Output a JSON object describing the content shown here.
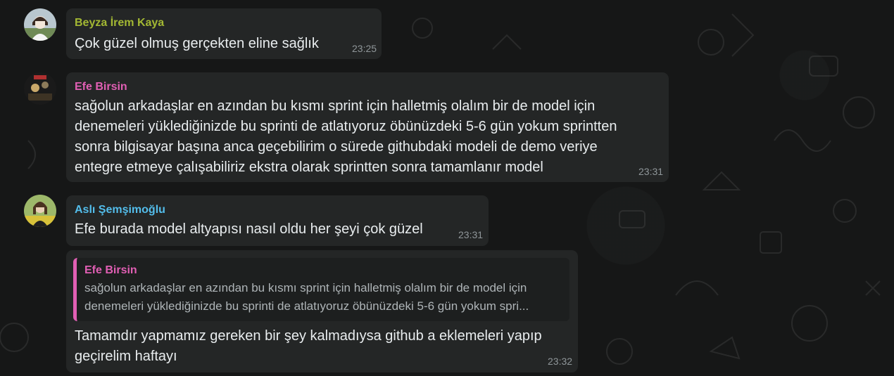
{
  "colors": {
    "background": "#161717",
    "bubble": "#242626",
    "message_text": "#e9edef",
    "time_text": "#8f9699"
  },
  "messages": [
    {
      "sender": "Beyza İrem Kaya",
      "sender_color": "#a3b833",
      "lines": [
        "Çok güzel olmuş gerçekten eline sağlık"
      ],
      "time": "23:25"
    },
    {
      "sender": "Efe Birsin",
      "sender_color": "#e15fb4",
      "lines": [
        "sağolun arkadaşlar en azından bu kısmı sprint için halletmiş olalım bir de model için",
        "denemeleri yüklediğinizde bu sprinti de atlatıyoruz öbünüzdeki 5-6 gün yokum sprintten",
        "sonra bilgisayar başına anca geçebilirim o sürede githubdaki modeli de demo veriye",
        "entegre etmeye çalışabiliriz ekstra olarak sprintten sonra tamamlanır model"
      ],
      "time": "23:31"
    },
    {
      "sender": "Aslı Şemşimoğlu",
      "sender_color": "#53bdeb",
      "lines": [
        "Efe burada model altyapısı nasıl oldu her şeyi çok güzel"
      ],
      "time": "23:31"
    },
    {
      "quote": {
        "sender": "Efe Birsin",
        "lines": [
          "sağolun arkadaşlar en azından bu kısmı sprint için halletmiş olalım bir de model için",
          "denemeleri yüklediğinizde bu sprinti de atlatıyoruz öbünüzdeki 5-6 gün yokum spri..."
        ]
      },
      "lines": [
        "Tamamdır yapmamız gereken bir şey kalmadıysa github a eklemeleri yapıp",
        "geçirelim haftayı"
      ],
      "time": "23:32"
    }
  ]
}
